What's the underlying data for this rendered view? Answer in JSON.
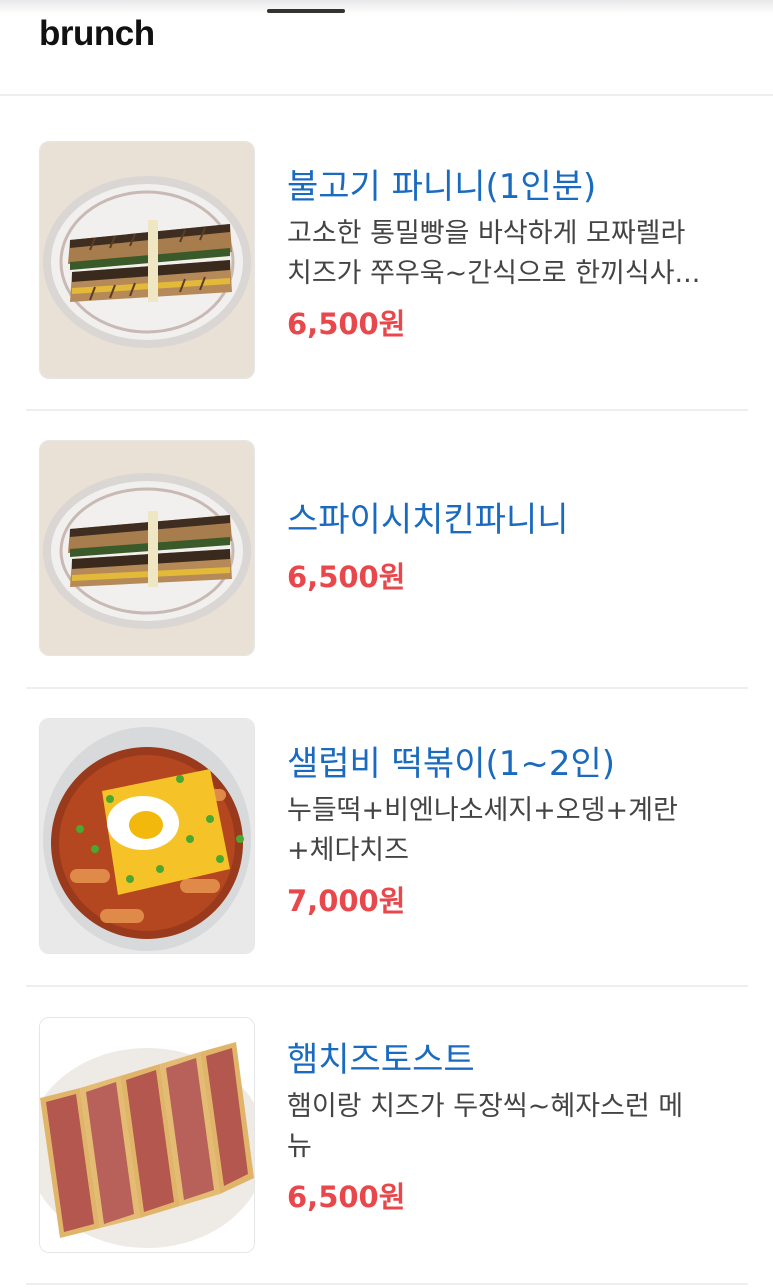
{
  "header": {
    "category_title": "brunch"
  },
  "items": [
    {
      "name": "불고기 파니니(1인분)",
      "desc_lines": [
        "고소한 통밀빵을 바삭하게 모짜렐라",
        "치즈가 쭈우욱~간식으로 한끼식사..."
      ],
      "price": "6,500원",
      "image": "panini-photo"
    },
    {
      "name": "스파이시치킨파니니",
      "desc_lines": [],
      "price": "6,500원",
      "image": "panini-photo"
    },
    {
      "name": "샐럽비 떡볶이(1~2인)",
      "desc_lines": [
        "누들떡+비엔나소세지+오뎅+계란",
        "+체다치즈"
      ],
      "price": "7,000원",
      "image": "tteokbokki-photo"
    },
    {
      "name": "햄치즈토스트",
      "desc_lines": [
        "햄이랑 치즈가 두장씩~혜자스런 메",
        "뉴"
      ],
      "price": "6,500원",
      "image": "toast-photo"
    }
  ],
  "colors": {
    "name": "#1a6bbf",
    "price": "#e8484b",
    "desc": "#444444"
  }
}
